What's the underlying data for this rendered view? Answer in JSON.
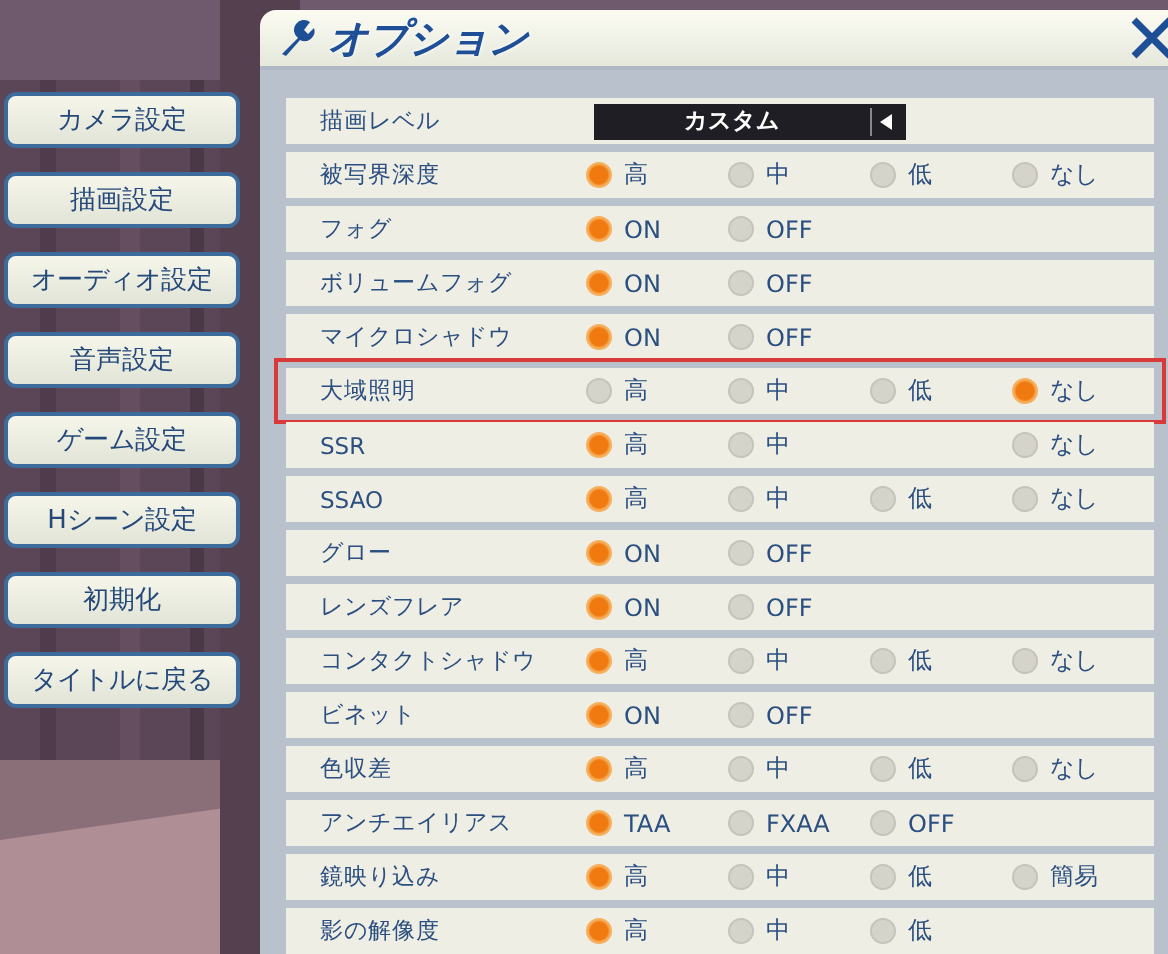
{
  "sidebar": {
    "items": [
      {
        "label": "カメラ設定"
      },
      {
        "label": "描画設定"
      },
      {
        "label": "オーディオ設定"
      },
      {
        "label": "音声設定"
      },
      {
        "label": "ゲーム設定"
      },
      {
        "label": "Hシーン設定"
      },
      {
        "label": "初期化"
      },
      {
        "label": "タイトルに戻る"
      }
    ]
  },
  "window": {
    "title": "オプション"
  },
  "rows": [
    {
      "label": "描画レベル",
      "kind": "select",
      "value": "カスタム",
      "highlighted": false
    },
    {
      "label": "被写界深度",
      "kind": "radio",
      "highlighted": false,
      "options": [
        {
          "label": "高",
          "selected": true
        },
        {
          "label": "中",
          "selected": false
        },
        {
          "label": "低",
          "selected": false
        },
        {
          "label": "なし",
          "selected": false
        }
      ]
    },
    {
      "label": "フォグ",
      "kind": "radio",
      "highlighted": false,
      "options": [
        {
          "label": "ON",
          "selected": true
        },
        {
          "label": "OFF",
          "selected": false
        }
      ]
    },
    {
      "label": "ボリュームフォグ",
      "kind": "radio",
      "highlighted": false,
      "options": [
        {
          "label": "ON",
          "selected": true
        },
        {
          "label": "OFF",
          "selected": false
        }
      ]
    },
    {
      "label": "マイクロシャドウ",
      "kind": "radio",
      "highlighted": false,
      "options": [
        {
          "label": "ON",
          "selected": true
        },
        {
          "label": "OFF",
          "selected": false
        }
      ]
    },
    {
      "label": "大域照明",
      "kind": "radio",
      "highlighted": true,
      "options": [
        {
          "label": "高",
          "selected": false
        },
        {
          "label": "中",
          "selected": false
        },
        {
          "label": "低",
          "selected": false
        },
        {
          "label": "なし",
          "selected": true
        }
      ]
    },
    {
      "label": "SSR",
      "kind": "radio",
      "highlighted": false,
      "options": [
        {
          "kind": "radio",
          "label": "高",
          "selected": true
        },
        {
          "kind": "radio",
          "label": "中",
          "selected": false
        },
        {
          "kind": "blank"
        },
        {
          "kind": "radio",
          "label": "なし",
          "selected": false
        }
      ]
    },
    {
      "label": "SSAO",
      "kind": "radio",
      "highlighted": false,
      "options": [
        {
          "label": "高",
          "selected": true
        },
        {
          "label": "中",
          "selected": false
        },
        {
          "label": "低",
          "selected": false
        },
        {
          "label": "なし",
          "selected": false
        }
      ]
    },
    {
      "label": "グロー",
      "kind": "radio",
      "highlighted": false,
      "options": [
        {
          "label": "ON",
          "selected": true
        },
        {
          "label": "OFF",
          "selected": false
        }
      ]
    },
    {
      "label": "レンズフレア",
      "kind": "radio",
      "highlighted": false,
      "options": [
        {
          "label": "ON",
          "selected": true
        },
        {
          "label": "OFF",
          "selected": false
        }
      ]
    },
    {
      "label": "コンタクトシャドウ",
      "kind": "radio",
      "highlighted": false,
      "options": [
        {
          "label": "高",
          "selected": true
        },
        {
          "label": "中",
          "selected": false
        },
        {
          "label": "低",
          "selected": false
        },
        {
          "label": "なし",
          "selected": false
        }
      ]
    },
    {
      "label": "ビネット",
      "kind": "radio",
      "highlighted": false,
      "options": [
        {
          "label": "ON",
          "selected": true
        },
        {
          "label": "OFF",
          "selected": false
        }
      ]
    },
    {
      "label": "色収差",
      "kind": "radio",
      "highlighted": false,
      "options": [
        {
          "label": "高",
          "selected": true
        },
        {
          "label": "中",
          "selected": false
        },
        {
          "label": "低",
          "selected": false
        },
        {
          "label": "なし",
          "selected": false
        }
      ]
    },
    {
      "label": "アンチエイリアス",
      "kind": "radio",
      "highlighted": false,
      "options": [
        {
          "label": "TAA",
          "selected": true
        },
        {
          "label": "FXAA",
          "selected": false
        },
        {
          "label": "OFF",
          "selected": false
        }
      ]
    },
    {
      "label": "鏡映り込み",
      "kind": "radio",
      "highlighted": false,
      "options": [
        {
          "label": "高",
          "selected": true
        },
        {
          "label": "中",
          "selected": false
        },
        {
          "label": "低",
          "selected": false
        },
        {
          "label": "簡易",
          "selected": false
        }
      ]
    },
    {
      "label": "影の解像度",
      "kind": "radio",
      "highlighted": false,
      "options": [
        {
          "label": "高",
          "selected": true
        },
        {
          "label": "中",
          "selected": false
        },
        {
          "label": "低",
          "selected": false
        }
      ]
    }
  ]
}
